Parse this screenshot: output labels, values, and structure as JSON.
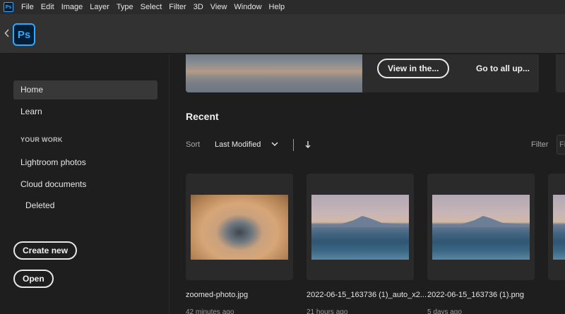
{
  "menubar": {
    "app_icon": "Ps",
    "items": [
      "File",
      "Edit",
      "Image",
      "Layer",
      "Type",
      "Select",
      "Filter",
      "3D",
      "View",
      "Window",
      "Help"
    ]
  },
  "titlebar": {
    "logo_text": "Ps"
  },
  "sidebar": {
    "home": "Home",
    "learn": "Learn",
    "section_label": "YOUR WORK",
    "lightroom": "Lightroom photos",
    "cloud": "Cloud documents",
    "deleted": "Deleted",
    "create_new": "Create new",
    "open": "Open"
  },
  "banner": {
    "view_button": "View in the...",
    "go_link": "Go to all up..."
  },
  "recent": {
    "title": "Recent",
    "sort_label": "Sort",
    "sort_value": "Last Modified",
    "filter_label": "Filter",
    "filter_placeholder": "Filt"
  },
  "files": [
    {
      "name": "zoomed-photo.jpg",
      "meta": "42 minutes ago"
    },
    {
      "name": "2022-06-15_163736 (1)_auto_x2...",
      "meta": "21 hours ago"
    },
    {
      "name": "2022-06-15_163736 (1).png",
      "meta": "5 days ago"
    }
  ],
  "colors": {
    "accent": "#31a8ff",
    "logo_bg": "#001e36"
  }
}
